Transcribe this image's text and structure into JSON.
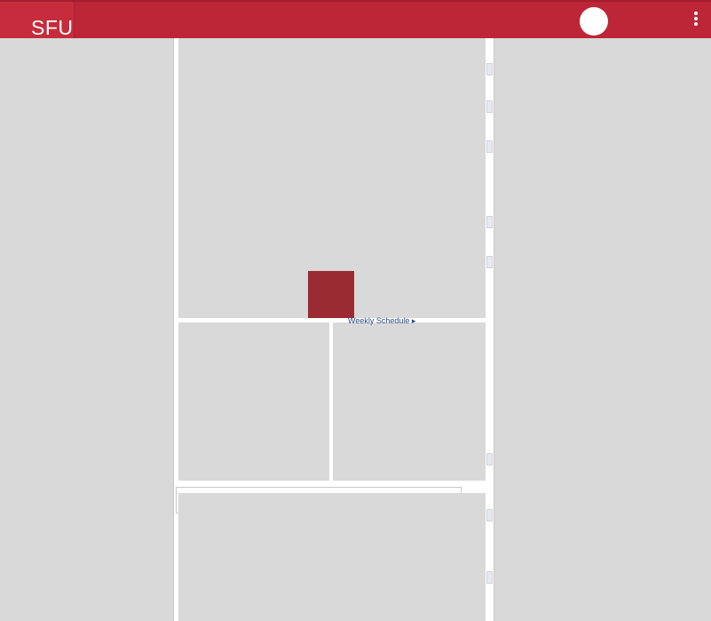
{
  "header": {
    "logo_text": "SFU",
    "brand_color": "#bd2637",
    "avatar_icon": "avatar-circle",
    "menu_icon": "kebab-menu-icon"
  },
  "content": {
    "schedule_link": "Weekly Schedule ▸"
  },
  "colors": {
    "placeholder_grey": "#d9d9d9",
    "highlight_red": "#9b2b32",
    "link_blue": "#2a4d8f"
  }
}
